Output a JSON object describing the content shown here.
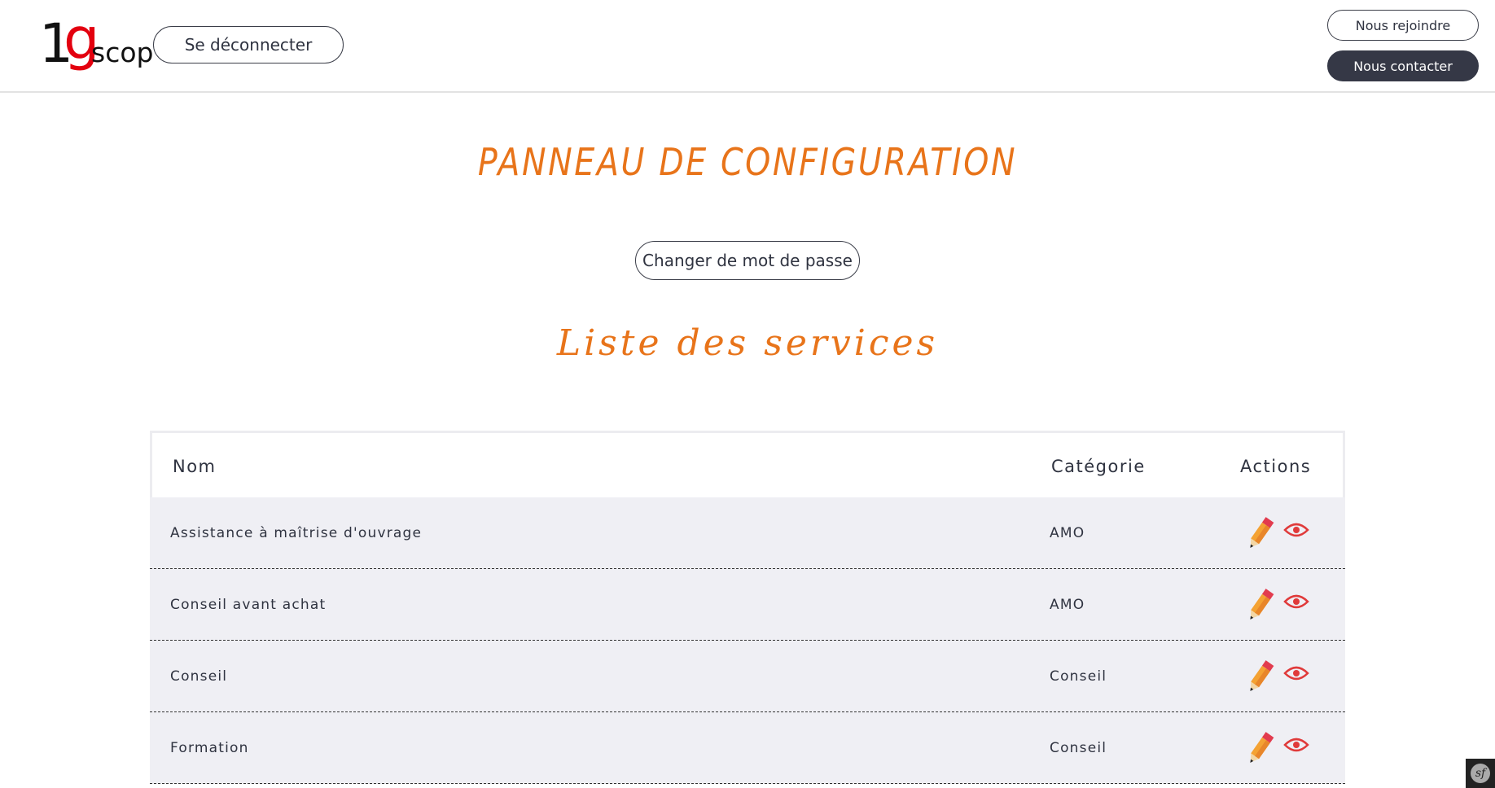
{
  "header": {
    "logo": {
      "one": "1",
      "g": "g",
      "scop": "scop"
    },
    "logout_label": "Se déconnecter",
    "join_label": "Nous rejoindre",
    "contact_label": "Nous contacter"
  },
  "main": {
    "title": "PANNEAU DE CONFIGURATION",
    "change_password_label": "Changer de mot de passe",
    "services_title": "Liste des services"
  },
  "table": {
    "headers": {
      "name": "Nom",
      "category": "Catégorie",
      "actions": "Actions"
    },
    "rows": [
      {
        "name": "Assistance à maîtrise d'ouvrage",
        "category": "AMO"
      },
      {
        "name": "Conseil avant achat",
        "category": "AMO"
      },
      {
        "name": "Conseil",
        "category": "Conseil"
      },
      {
        "name": "Formation",
        "category": "Conseil"
      }
    ]
  },
  "icons": {
    "edit": "pencil-icon",
    "view": "eye-icon",
    "debug": "symfony-icon"
  },
  "colors": {
    "accent": "#e8741a",
    "brand_red": "#e3000f",
    "dark_button": "#353846",
    "row_bg": "#efeff4",
    "eye": "#e03a3a"
  }
}
